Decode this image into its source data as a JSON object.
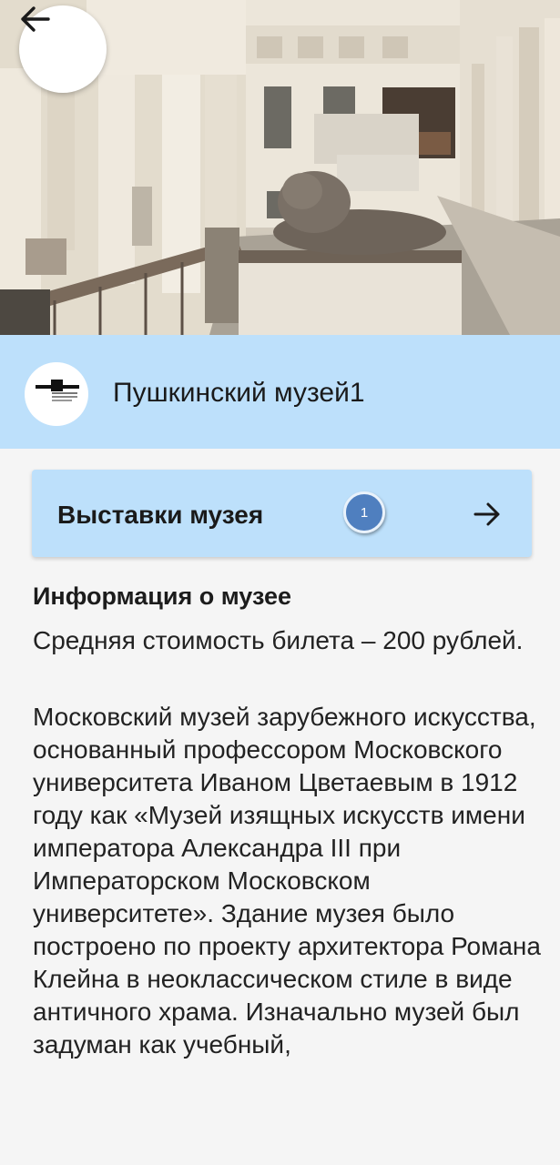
{
  "hero": {
    "image_alt": "museum-hall-photo"
  },
  "navigation": {
    "back_icon": "arrow-left-icon"
  },
  "header": {
    "title": "Пушкинский музей1",
    "logo_icon": "museum-logo-icon"
  },
  "exhibitions": {
    "label": "Выставки музея",
    "count": "1",
    "arrow_icon": "arrow-right-icon"
  },
  "info": {
    "heading": "Информация о музее",
    "price": "Средняя стоимость билета – 200 рублей.",
    "description": "Московский музей зарубежного искусства, основанный профессором Московского университета Иваном Цветаевым в 1912 году как «Музей изящных искусств имени императора Александра III при Императорском Московском университете». Здание музея было построено по проекту архитектора Романа Клейна в неоклассическом стиле в виде античного храма. Изначально музей был задуман как учебный,"
  },
  "colors": {
    "header_background": "#bde0fb",
    "badge": "#4f7fbf",
    "page_background": "#f5f5f5"
  }
}
